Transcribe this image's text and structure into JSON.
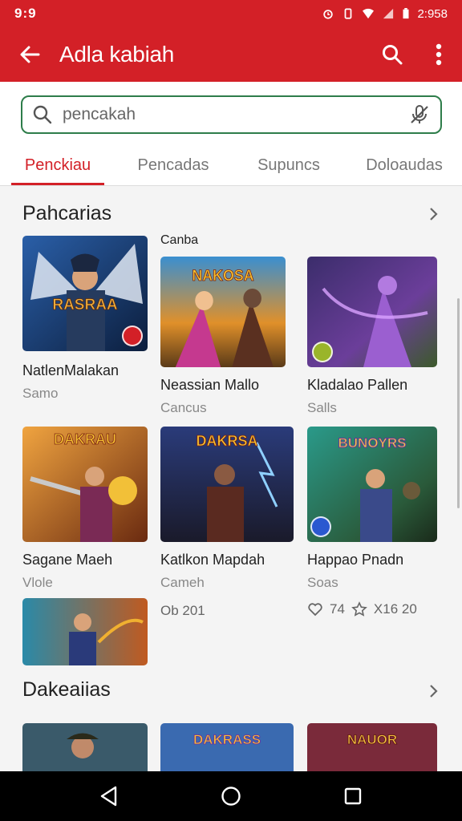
{
  "status_bar": {
    "time": "9:9",
    "battery_text": "2:958"
  },
  "app_bar": {
    "title": "Adla kabiah",
    "back_icon": "arrow-left-icon",
    "search_icon": "search-icon",
    "menu_icon": "more-vert-icon"
  },
  "search": {
    "placeholder": "pencakah",
    "value": "",
    "mic_icon": "mic-off-icon"
  },
  "tabs": [
    {
      "label": "Penckiau",
      "active": true
    },
    {
      "label": "Pencadas",
      "active": false
    },
    {
      "label": "Supuncs",
      "active": false
    },
    {
      "label": "Doloaudas",
      "active": false
    }
  ],
  "section1": {
    "title": "Pahcarias",
    "caption": "Canba",
    "cards": [
      {
        "name": "NatlenMalakan",
        "sub": "Samo",
        "art_text": "RASRAA"
      },
      {
        "name": "Neassian Mallo",
        "sub": "Cancus",
        "art_text": "NAKOSA"
      },
      {
        "name": "Kladalao Pallen",
        "sub": "Salls",
        "art_text": ""
      },
      {
        "name": "Sagane Maeh",
        "sub": "Vlole",
        "art_text": "DAKRAU"
      },
      {
        "name": "Katlkon Mapdah",
        "sub": "Cameh",
        "art_text": "DAKRSA"
      },
      {
        "name": "Happao Pnadn",
        "sub": "Soas",
        "art_text": "BUNOYRS"
      }
    ],
    "extra_meta": "Ob 201",
    "stats": {
      "likes": "74",
      "rating": "X16 20"
    }
  },
  "section2": {
    "title": "Dakeaiias",
    "art_texts": [
      "",
      "DAKRASS",
      "NAUOR"
    ]
  },
  "colors": {
    "primary": "#d32027",
    "search_border": "#2e7d4a"
  }
}
